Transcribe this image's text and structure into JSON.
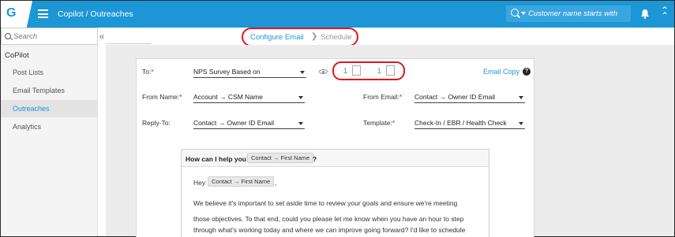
{
  "app": {
    "logo": "G",
    "breadcrumb": "Copilot / Outreaches"
  },
  "header": {
    "search_placeholder": "Customer name starts with",
    "icons": [
      "search-icon",
      "bell-icon",
      "collapse-up-icon"
    ]
  },
  "sidebar": {
    "search_placeholder": "Search",
    "heading": "CoPilot",
    "items": [
      {
        "label": "Post Lists",
        "active": false
      },
      {
        "label": "Email Templates",
        "active": false
      },
      {
        "label": "Outreaches",
        "active": true
      },
      {
        "label": "Analytics",
        "active": false
      }
    ]
  },
  "wizard": {
    "step1": "Configure Email",
    "separator": "❯",
    "step2": "Schedule"
  },
  "form": {
    "to_label": "To:",
    "to_value": "NPS Survey Based on",
    "company_count": "1",
    "contact_count": "1",
    "email_copy": "Email Copy",
    "help": "?",
    "from_name_label": "From Name:",
    "from_name_value": "Account → CSM Name",
    "from_email_label": "From Email:",
    "from_email_value": "Contact → Owner ID Email",
    "reply_to_label": "Reply-To:",
    "reply_to_value": "Contact → Owner ID Email",
    "template_label": "Template:",
    "template_value": "Check-In / EBR / Health Check",
    "required_mark": "*"
  },
  "email": {
    "subject_prefix": "How can I help you",
    "subject_token": "Contact → First Name",
    "subject_suffix": "?",
    "greeting": "Hey",
    "greeting_token": "Contact → First Name",
    "greeting_comma": ",",
    "para1": "We believe it's important to set aside time to review your goals and ensure we're meeting",
    "para1_cont": "those objectives. To that end, could you please let me know when you have an hour to step through what's working today and where we can improve going forward? I'd like to schedule before the end of this month. I look forward to hearing from you."
  },
  "colors": {
    "brand": "#1d96d6",
    "highlight": "#e4141b"
  }
}
